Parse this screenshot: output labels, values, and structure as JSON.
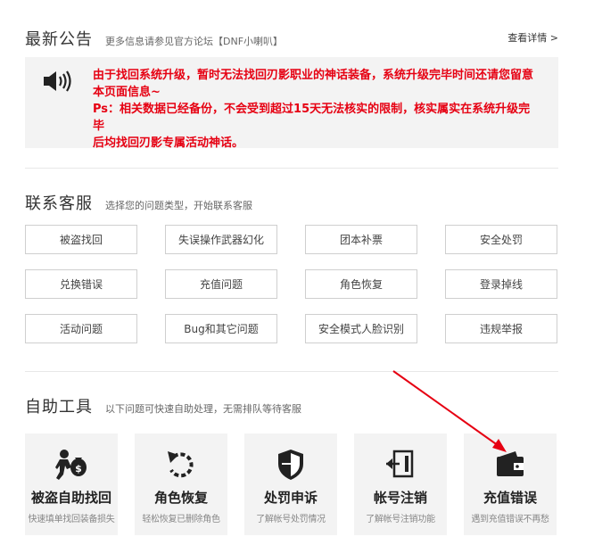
{
  "announcement": {
    "title": "最新公告",
    "subtitle": "更多信息请参见官方论坛【DNF小喇叭】",
    "more_link": "查看详情 >",
    "icon": "speaker-icon",
    "line1": "由于找回系统升级，暂时无法找回刃影职业的神话装备，系统升级完毕时间还请您留意",
    "line2": "本页面信息~",
    "line3": "Ps：相关数据已经备份，不会受到超过15天无法核实的限制，核实属实在系统升级完毕",
    "line4": "后均找回刃影专属活动神话。",
    "text_color": "#e60012"
  },
  "service": {
    "title": "联系客服",
    "subtitle": "选择您的问题类型，开始联系客服",
    "buttons": [
      "被盗找回",
      "失误操作武器幻化",
      "团本补票",
      "安全处罚",
      "兑换错误",
      "充值问题",
      "角色恢复",
      "登录掉线",
      "活动问题",
      "Bug和其它问题",
      "安全模式人脸识别",
      "违规举报"
    ]
  },
  "tools": {
    "title": "自助工具",
    "subtitle": "以下问题可快速自助处理，无需排队等待客服",
    "items": [
      {
        "name": "被盗自助找回",
        "desc": "快速填单找回装备损失",
        "icon": "thief-money-bag-icon"
      },
      {
        "name": "角色恢复",
        "desc": "轻松恢复已删除角色",
        "icon": "restore-arrow-icon"
      },
      {
        "name": "处罚申诉",
        "desc": "了解帐号处罚情况",
        "icon": "shield-icon"
      },
      {
        "name": "帐号注销",
        "desc": "了解帐号注销功能",
        "icon": "logout-door-icon"
      },
      {
        "name": "充值错误",
        "desc": "遇到充值错误不再愁",
        "icon": "wallet-icon"
      }
    ]
  },
  "annotation_color": "#e60012"
}
